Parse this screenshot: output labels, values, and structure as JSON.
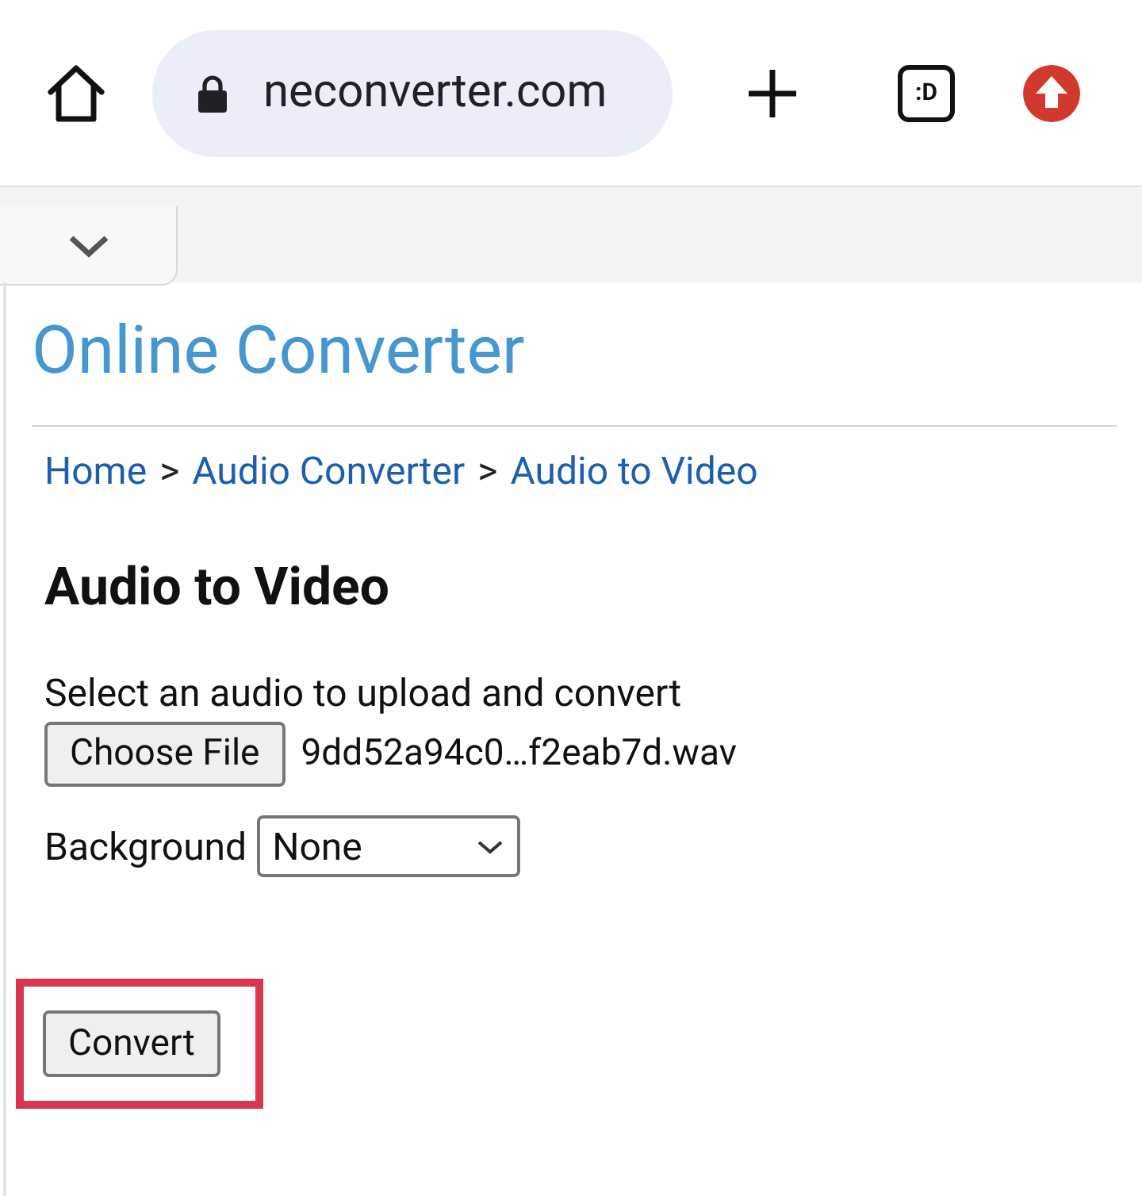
{
  "browser": {
    "url": "neconverter.com",
    "extension_badge": ":D"
  },
  "site_title": "Online Converter",
  "breadcrumb": [
    {
      "label": "Home"
    },
    {
      "label": "Audio Converter"
    },
    {
      "label": "Audio to Video"
    }
  ],
  "breadcrumb_separator": ">",
  "heading": "Audio to Video",
  "instruction": "Select an audio to upload and convert",
  "file_input": {
    "button": "Choose File",
    "file_name": "9dd52a94c0…f2eab7d.wav"
  },
  "background": {
    "label": "Background",
    "value": "None"
  },
  "convert_button": {
    "label": "Convert",
    "highlighted": true
  }
}
